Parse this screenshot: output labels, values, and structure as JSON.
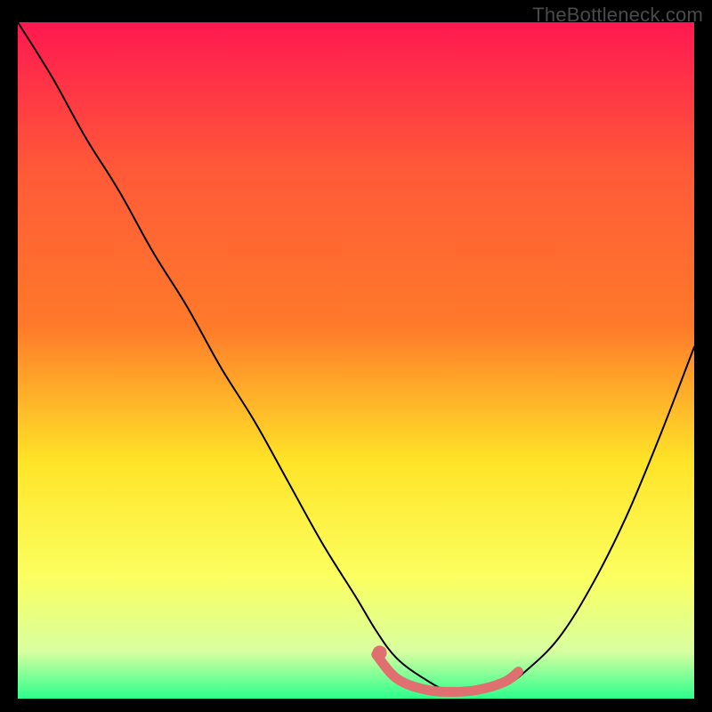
{
  "watermark": "TheBottleneck.com",
  "chart_data": {
    "type": "line",
    "title": "",
    "xlabel": "",
    "ylabel": "",
    "xlim": [
      0,
      100
    ],
    "ylim": [
      0,
      100
    ],
    "grid": false,
    "legend": false,
    "background_gradient": {
      "top": "#ff1850",
      "mid_upper": "#ff7a2a",
      "mid": "#ffe428",
      "mid_lower": "#fbff60",
      "near_bottom": "#d8ffa0",
      "bottom": "#2cff8d"
    },
    "series": [
      {
        "name": "bottleneck-curve",
        "stroke": "#000000",
        "type": "line",
        "x": [
          0,
          5,
          10,
          15,
          20,
          25,
          30,
          35,
          40,
          45,
          50,
          53,
          56,
          60,
          64,
          68,
          72,
          75,
          80,
          85,
          90,
          95,
          100
        ],
        "y": [
          100,
          92,
          83,
          75,
          66,
          58,
          49,
          41,
          32,
          23,
          15,
          10,
          6,
          3,
          1,
          1,
          2,
          4,
          9,
          17,
          27,
          39,
          52
        ]
      },
      {
        "name": "bottleneck-highlight-band",
        "stroke": "#e07070",
        "type": "line",
        "x": [
          53,
          56,
          60,
          64,
          68,
          72,
          74
        ],
        "y": [
          6.5,
          3.0,
          1.4,
          1.0,
          1.3,
          2.5,
          4.0
        ]
      },
      {
        "name": "bottleneck-highlight-dot",
        "stroke": "#e07070",
        "type": "scatter",
        "x": [
          53.5
        ],
        "y": [
          6.8
        ]
      }
    ]
  }
}
